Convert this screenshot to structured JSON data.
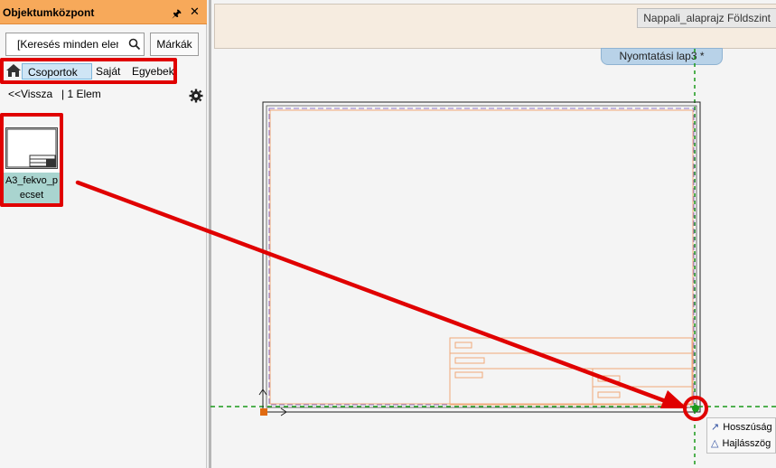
{
  "panel": {
    "title": "Objektumközpont",
    "pin_icon": "pin-icon",
    "close_icon": "close-icon",
    "search_placeholder": "[Keresés minden elem",
    "brands_label": "Márkák",
    "breadcrumb": {
      "home_icon": "home-icon",
      "items": [
        "Csoportok",
        "Saját",
        "Egyebek"
      ]
    },
    "back_label": "<<Vissza",
    "count_label": "| 1 Elem",
    "settings_icon": "gear-icon",
    "items": [
      {
        "name": "A3_fekvo_p\necset"
      }
    ]
  },
  "main": {
    "document_tab": "Nappali_alaprajz Földszint",
    "print_tab": "Nyomtatási lap3 *"
  },
  "tooltip": {
    "rows": [
      {
        "icon": "length-icon",
        "label": "Hosszúság"
      },
      {
        "icon": "angle-icon",
        "label": "Hajlásszög"
      }
    ]
  },
  "colors": {
    "panel_header": "#f7a95a",
    "highlight": "#e00000",
    "guide_line": "#1a9a1a",
    "frame_orange": "#f0a878"
  }
}
